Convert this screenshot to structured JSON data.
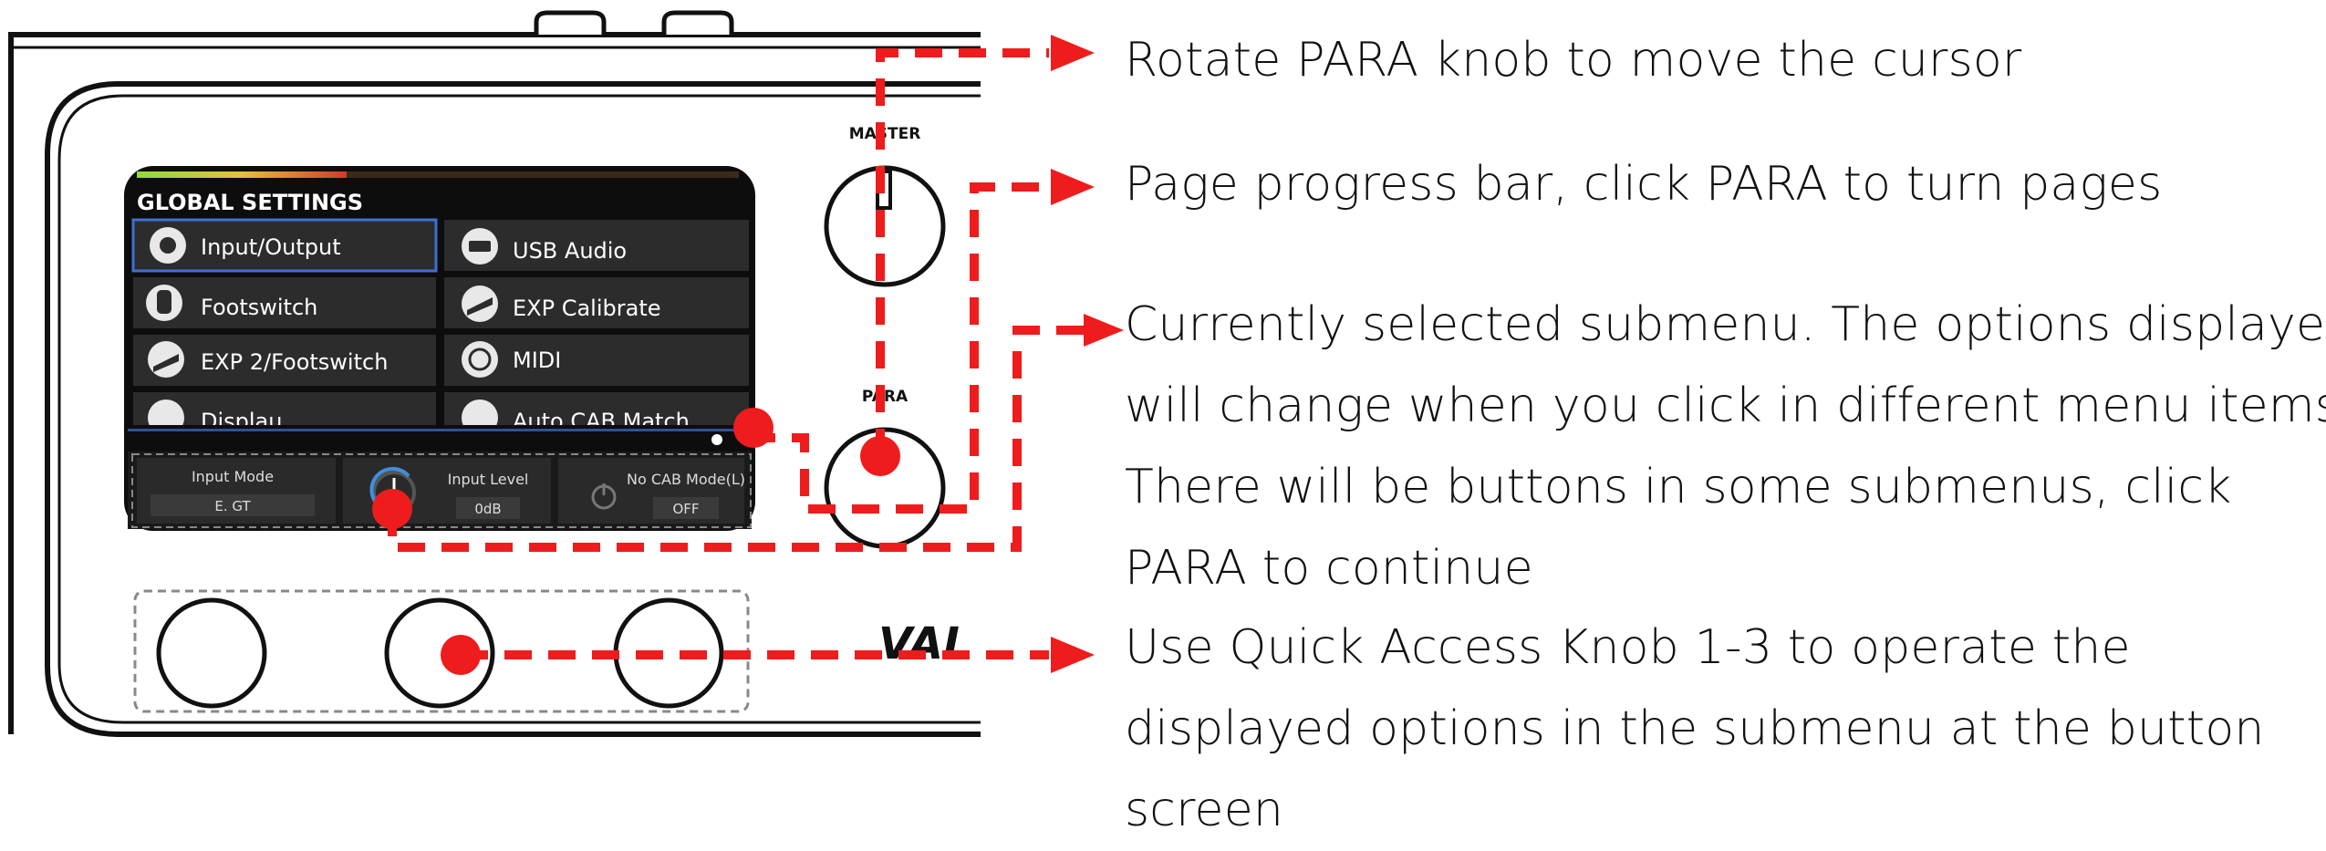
{
  "colors": {
    "callout_red": "#ee1c1c",
    "screen_bg": "#0d0d0d",
    "tile_bg": "#2c2c2c",
    "selected_border": "#3f6fd6",
    "device_outline": "#111111"
  },
  "device": {
    "master_label": "MASTER",
    "para_label": "PARA",
    "brand_label": "VAL"
  },
  "screen": {
    "title": "GLOBAL SETTINGS",
    "menu_items": [
      {
        "label": "Input/Output",
        "icon": "input-output-icon",
        "selected": true
      },
      {
        "label": "USB Audio",
        "icon": "usb-audio-icon",
        "selected": false
      },
      {
        "label": "Footswitch",
        "icon": "footswitch-icon",
        "selected": false
      },
      {
        "label": "EXP Calibrate",
        "icon": "exp-calibrate-icon",
        "selected": false
      },
      {
        "label": "EXP 2/Footswitch",
        "icon": "exp2-footswitch-icon",
        "selected": false
      },
      {
        "label": "MIDI",
        "icon": "midi-icon",
        "selected": false
      },
      {
        "label": "Displau",
        "icon": "display-icon",
        "selected": false
      },
      {
        "label": "Auto CAB Match",
        "icon": "auto-cab-match-icon",
        "selected": false
      }
    ],
    "params": [
      {
        "label": "Input Mode",
        "value": "E. GT",
        "icon": ""
      },
      {
        "label": "Input Level",
        "value": "0dB",
        "icon": "knob-dial-icon"
      },
      {
        "label": "No CAB Mode(L)",
        "value": "OFF",
        "icon": "power-icon"
      }
    ]
  },
  "callouts": {
    "cursor": [
      "Rotate PARA knob to move the cursor"
    ],
    "progress": [
      "Page progress bar, click PARA to turn pages"
    ],
    "submenu": [
      "Currently selected submenu. The options displayed",
      "will change when you click in different menu items.",
      "There will be buttons in some submenus, click",
      "PARA to continue"
    ],
    "quick_access": [
      "Use Quick Access Knob 1-3 to operate the",
      "displayed options in the submenu at the button",
      "screen"
    ]
  }
}
